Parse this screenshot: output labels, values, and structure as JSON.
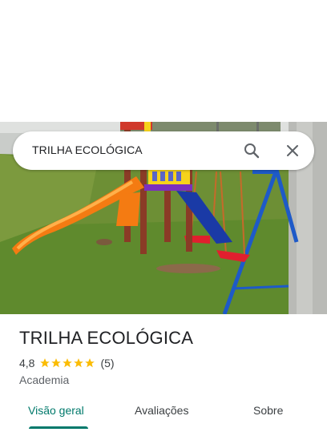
{
  "search": {
    "query": "TRILHA ECOLÓGICA"
  },
  "place": {
    "name": "TRILHA ECOLÓGICA",
    "rating": "4,8",
    "stars": 5,
    "review_count": "(5)",
    "category": "Academia"
  },
  "tabs": [
    {
      "label": "Visão geral",
      "active": true
    },
    {
      "label": "Avaliações",
      "active": false
    },
    {
      "label": "Sobre",
      "active": false
    }
  ],
  "colors": {
    "accent": "#00796b",
    "star": "#fbbc04",
    "text": "#202124",
    "muted": "#5f6368"
  },
  "icons": {
    "search": "search-icon",
    "close": "close-icon",
    "star": "star-icon"
  }
}
